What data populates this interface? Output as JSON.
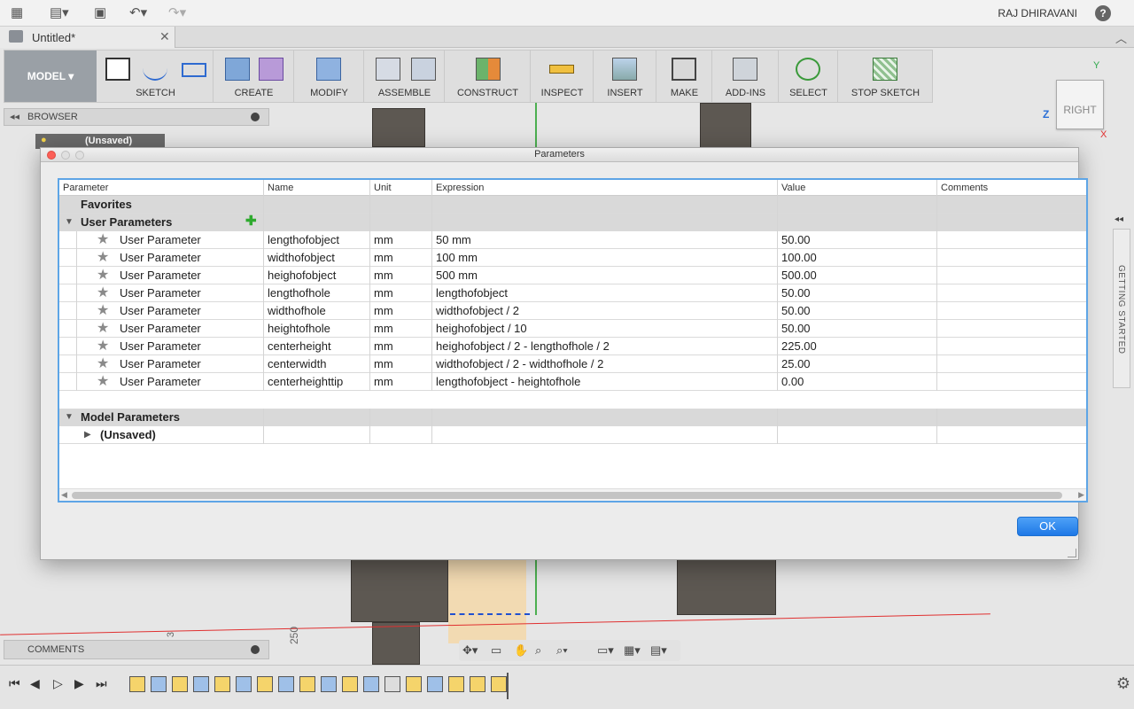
{
  "appbar": {
    "user": "RAJ DHIRAVANI",
    "help": "?"
  },
  "tab": {
    "title": "Untitled*"
  },
  "toolbar": {
    "model": "MODEL",
    "groups": [
      "SKETCH",
      "CREATE",
      "MODIFY",
      "ASSEMBLE",
      "CONSTRUCT",
      "INSPECT",
      "INSERT",
      "MAKE",
      "ADD-INS",
      "SELECT",
      "STOP SKETCH"
    ]
  },
  "browser": {
    "title": "BROWSER",
    "root": "(Unsaved)"
  },
  "comments": {
    "title": "COMMENTS"
  },
  "viewcube": {
    "face": "RIGHT",
    "axis_y": "Y",
    "axis_z": "Z",
    "axis_x": "X"
  },
  "side_panel": {
    "label": "GETTING STARTED"
  },
  "canvas_labels": {
    "ruler_a": "250",
    "ruler_b": "3"
  },
  "dialog": {
    "title": "Parameters",
    "ok": "OK",
    "columns": [
      "Parameter",
      "Name",
      "Unit",
      "Expression",
      "Value",
      "Comments"
    ],
    "sections": {
      "favorites": "Favorites",
      "user": "User Parameters",
      "model": "Model Parameters",
      "model_child": "(Unsaved)"
    },
    "rows": [
      {
        "param": "User Parameter",
        "name": "lengthofobject",
        "unit": "mm",
        "expr": "50 mm",
        "value": "50.00"
      },
      {
        "param": "User Parameter",
        "name": "widthofobject",
        "unit": "mm",
        "expr": "100 mm",
        "value": "100.00"
      },
      {
        "param": "User Parameter",
        "name": "heighofobject",
        "unit": "mm",
        "expr": "500 mm",
        "value": "500.00"
      },
      {
        "param": "User Parameter",
        "name": "lengthofhole",
        "unit": "mm",
        "expr": "lengthofobject",
        "value": "50.00"
      },
      {
        "param": "User Parameter",
        "name": "widthofhole",
        "unit": "mm",
        "expr": "widthofobject / 2",
        "value": "50.00"
      },
      {
        "param": "User Parameter",
        "name": "heightofhole",
        "unit": "mm",
        "expr": "heighofobject / 10",
        "value": "50.00"
      },
      {
        "param": "User Parameter",
        "name": "centerheight",
        "unit": "mm",
        "expr": "heighofobject / 2 - lengthofhole / 2",
        "value": "225.00"
      },
      {
        "param": "User Parameter",
        "name": "centerwidth",
        "unit": "mm",
        "expr": "widthofobject / 2 - widthofhole / 2",
        "value": "25.00"
      },
      {
        "param": "User Parameter",
        "name": "centerheighttip",
        "unit": "mm",
        "expr": "lengthofobject - heightofhole",
        "value": "0.00"
      }
    ]
  }
}
